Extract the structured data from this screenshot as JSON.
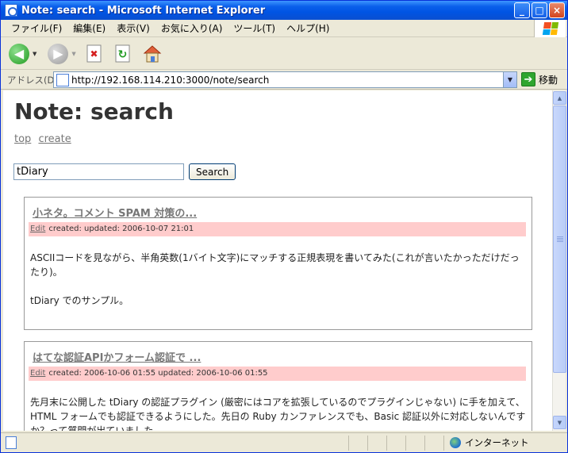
{
  "window": {
    "title": "Note: search - Microsoft Internet Explorer",
    "buttons": {
      "minimize": "_",
      "maximize": "□",
      "close": "×"
    }
  },
  "menu": [
    "ファイル(F)",
    "編集(E)",
    "表示(V)",
    "お気に入り(A)",
    "ツール(T)",
    "ヘルプ(H)"
  ],
  "toolbar": {
    "icons": [
      "back-icon",
      "forward-icon",
      "stop-icon",
      "refresh-icon",
      "home-icon"
    ]
  },
  "address": {
    "label": "アドレス(D)",
    "url": "http://192.168.114.210:3000/note/search",
    "go_label": "移動"
  },
  "page": {
    "title": "Note: search",
    "links": {
      "top": "top",
      "create": "create"
    },
    "search": {
      "value": "tDiary",
      "button": "Search"
    },
    "entries": [
      {
        "title": "小ネタ。コメント SPAM 対策の...",
        "edit": "Edit",
        "meta": "created: updated: 2006-10-07 21:01",
        "paragraphs": [
          "ASCIIコードを見ながら、半角英数(1バイト文字)にマッチする正規表現を書いてみた(これが言いたかっただけだったり)。",
          "tDiary でのサンプル。"
        ]
      },
      {
        "title": "はてな認証APIかフォーム認証で ...",
        "edit": "Edit",
        "meta": "created: 2006-10-06 01:55 updated: 2006-10-06 01:55",
        "paragraphs": [
          "先月末に公開した tDiary の認証プラグイン (厳密にはコアを拡張しているのでプラグインじゃない) に手を加えて、HTML フォームでも認証できるようにした。先日の Ruby カンファレンスでも、Basic 認証以外に対応しないんですか？って質問が出ていました。"
        ]
      }
    ]
  },
  "status": {
    "zone": "インターネット"
  },
  "colors": {
    "titlebar": "#0054e3",
    "meta_bg": "#ffcccc",
    "chrome": "#ece9d8"
  }
}
